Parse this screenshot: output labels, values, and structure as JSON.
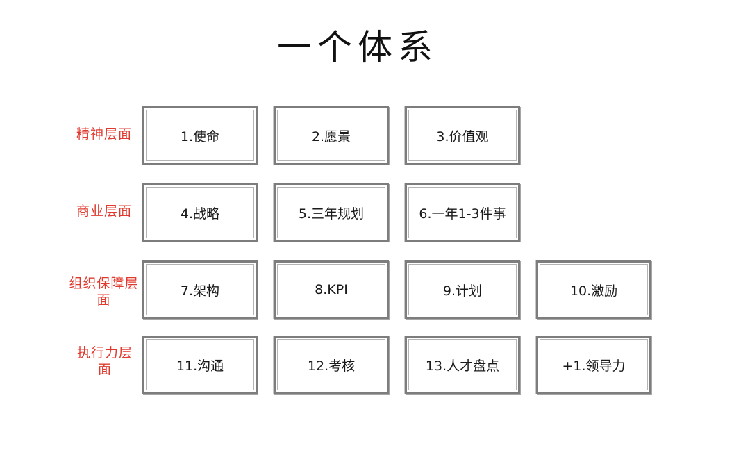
{
  "title": "一个体系",
  "rows": [
    {
      "label": "精神层面",
      "items": [
        "1.使命",
        "2.愿景",
        "3.价值观"
      ]
    },
    {
      "label": "商业层面",
      "items": [
        "4.战略",
        "5.三年规划",
        "6.一年1-3件事"
      ]
    },
    {
      "label": "组织保障层面",
      "items": [
        "7.架构",
        "8.KPI",
        "9.计划",
        "10.激励"
      ]
    },
    {
      "label": "执行力层面",
      "items": [
        "11.沟通",
        "12.考核",
        "13.人才盘点",
        "+1.领导力"
      ]
    }
  ],
  "colors": {
    "label": "#e03a2f",
    "box_border": "#7d7d7d",
    "text": "#1a1a1a"
  }
}
